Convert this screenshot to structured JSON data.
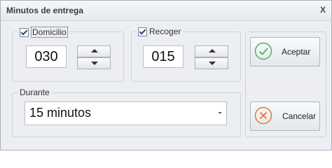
{
  "window": {
    "title": "Minutos de entrega",
    "close_label": "X"
  },
  "domicilio": {
    "label": "Domicilio",
    "checked": true,
    "value": "030"
  },
  "recoger": {
    "label": "Recoger",
    "checked": true,
    "value": "015"
  },
  "durante": {
    "label": "Durante",
    "selected": "15 minutos"
  },
  "buttons": {
    "accept_label": "Aceptar",
    "cancel_label": "Cancelar"
  },
  "colors": {
    "accept_icon": "#4db26a",
    "cancel_icon": "#e8743c"
  },
  "icons": {
    "accept": "check-circle-icon",
    "cancel": "x-circle-icon"
  }
}
